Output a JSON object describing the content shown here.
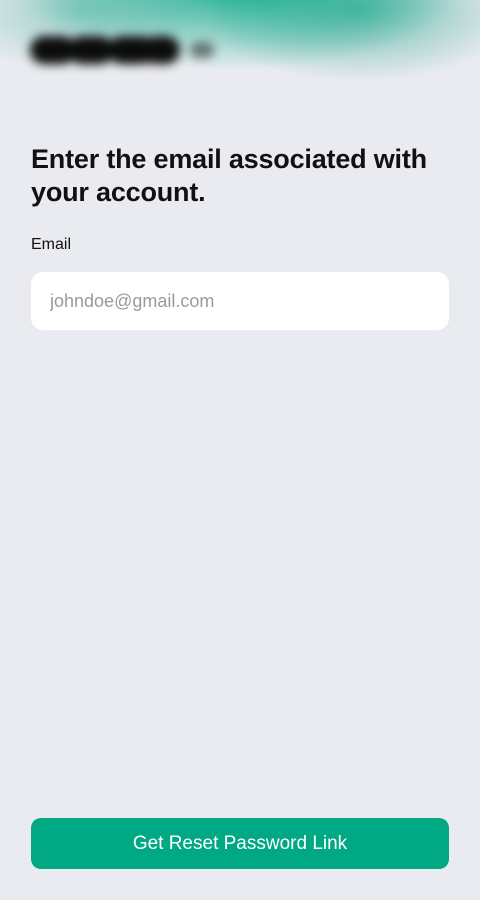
{
  "header": {
    "logo_icon": "brand-logo-blurred"
  },
  "form": {
    "heading": "Enter the email associated with your account.",
    "email_label": "Email",
    "email_placeholder": "johndoe@gmail.com",
    "email_value": ""
  },
  "actions": {
    "submit_label": "Get Reset Password Link"
  },
  "colors": {
    "accent": "#00a884",
    "background": "#e9ebf0",
    "field_background": "#ffffff"
  }
}
